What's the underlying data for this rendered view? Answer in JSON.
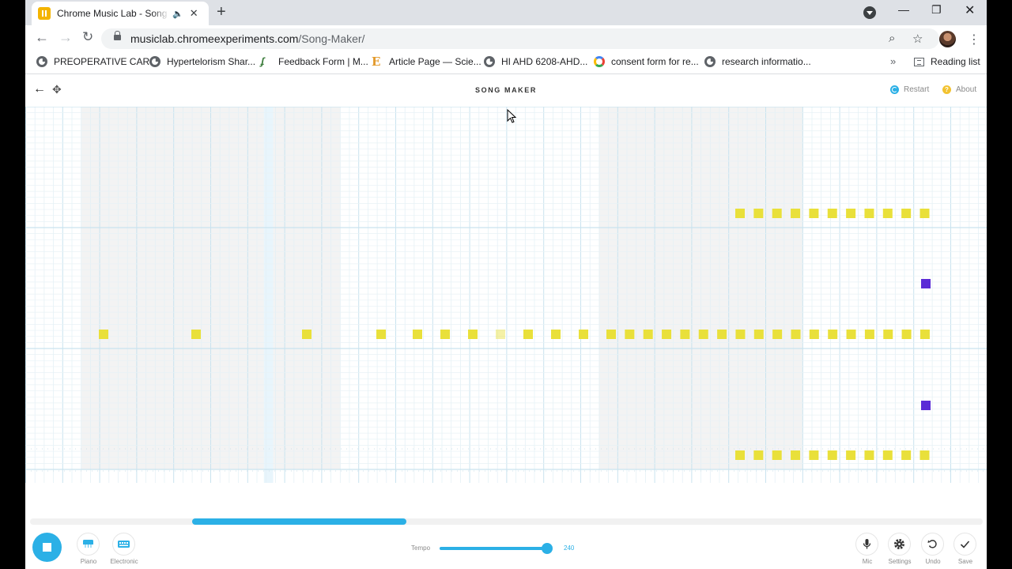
{
  "browser": {
    "tab_title": "Chrome Music Lab - Song Maker",
    "url_host": "musiclab.chromeexperiments.com",
    "url_path": "/Song-Maker/",
    "bookmarks": [
      {
        "label": "PREOPERATIVE CAR...",
        "icon": "globe-icon"
      },
      {
        "label": "Hypertelorism Shar...",
        "icon": "globe-icon"
      },
      {
        "label": "Feedback Form | M...",
        "icon": "feedback-icon"
      },
      {
        "label": "Article Page — Scie...",
        "icon": "e-letter-icon"
      },
      {
        "label": "HI AHD 6208-AHD...",
        "icon": "globe-icon"
      },
      {
        "label": "consent form for re...",
        "icon": "google-icon"
      },
      {
        "label": "research informatio...",
        "icon": "globe-icon"
      }
    ],
    "reading_list": "Reading list",
    "more_bookmarks": "»"
  },
  "app": {
    "title": "SONG MAKER",
    "restart": "Restart",
    "about": "About",
    "grid": {
      "columns": 52,
      "rows": 20,
      "highlight_column": 26,
      "accent_color": "#2bb0e6",
      "melody_color": "#e9e03a",
      "percussion_color": "#5b2bd6",
      "melody_notes": [
        {
          "col": 4,
          "row": 16
        },
        {
          "col": 9,
          "row": 16
        },
        {
          "col": 15,
          "row": 16
        },
        {
          "col": 19,
          "row": 16
        },
        {
          "col": 21,
          "row": 16
        },
        {
          "col": 22,
          "row": 16
        },
        {
          "col": 24,
          "row": 16
        },
        {
          "col": 26,
          "row": 16,
          "faded": true
        },
        {
          "col": 27,
          "row": 16
        },
        {
          "col": 29,
          "row": 16
        },
        {
          "col": 30,
          "row": 16
        },
        {
          "col": 32,
          "row": 16
        },
        {
          "col": 33,
          "row": 16
        },
        {
          "col": 34,
          "row": 16
        },
        {
          "col": 35,
          "row": 16
        },
        {
          "col": 36,
          "row": 16
        },
        {
          "col": 37,
          "row": 16
        },
        {
          "col": 38,
          "row": 16
        },
        {
          "col": 39,
          "row": 16
        },
        {
          "col": 40,
          "row": 16
        },
        {
          "col": 41,
          "row": 16
        },
        {
          "col": 42,
          "row": 16
        },
        {
          "col": 43,
          "row": 16
        },
        {
          "col": 44,
          "row": 16
        },
        {
          "col": 45,
          "row": 16
        },
        {
          "col": 46,
          "row": 16
        },
        {
          "col": 47,
          "row": 16
        },
        {
          "col": 48,
          "row": 16
        },
        {
          "col": 49,
          "row": 16
        },
        {
          "col": 38,
          "row": 9
        },
        {
          "col": 39,
          "row": 9
        },
        {
          "col": 40,
          "row": 9
        },
        {
          "col": 41,
          "row": 9
        },
        {
          "col": 42,
          "row": 9
        },
        {
          "col": 43,
          "row": 9
        },
        {
          "col": 44,
          "row": 9
        },
        {
          "col": 45,
          "row": 9
        },
        {
          "col": 46,
          "row": 9
        },
        {
          "col": 47,
          "row": 9
        },
        {
          "col": 48,
          "row": 9
        },
        {
          "col": 38,
          "row": 22
        },
        {
          "col": 39,
          "row": 22
        },
        {
          "col": 40,
          "row": 22
        },
        {
          "col": 41,
          "row": 22
        },
        {
          "col": 42,
          "row": 22
        },
        {
          "col": 43,
          "row": 22
        },
        {
          "col": 44,
          "row": 22
        },
        {
          "col": 45,
          "row": 22
        },
        {
          "col": 46,
          "row": 22
        },
        {
          "col": 47,
          "row": 22
        },
        {
          "col": 48,
          "row": 22
        }
      ],
      "percussion_notes": [
        {
          "col": 49,
          "row": 12
        },
        {
          "col": 49,
          "row": 18
        }
      ]
    },
    "scroll_position": 0.22,
    "instruments": [
      {
        "label": "Piano",
        "icon": "piano-icon"
      },
      {
        "label": "Electronic",
        "icon": "electronic-keyboard-icon"
      }
    ],
    "tempo": {
      "label": "Tempo",
      "value": "240",
      "fraction": 0.96
    },
    "actions": [
      {
        "label": "Mic",
        "icon": "mic-icon"
      },
      {
        "label": "Settings",
        "icon": "gear-icon"
      },
      {
        "label": "Undo",
        "icon": "undo-icon"
      },
      {
        "label": "Save",
        "icon": "check-icon"
      }
    ]
  }
}
